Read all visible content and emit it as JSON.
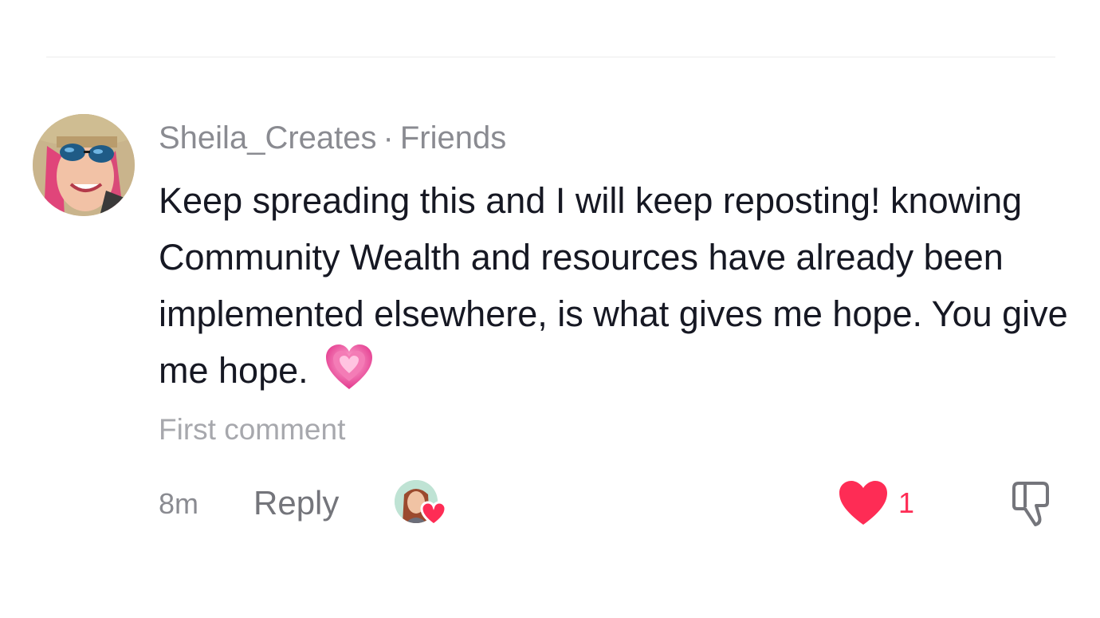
{
  "comment": {
    "username": "Sheila_Creates",
    "separator": "·",
    "relationship": "Friends",
    "text": "Keep spreading this and I will keep reposting! knowing Community Wealth and resources have already been implemented elsewhere, is what gives me hope. You give me hope.",
    "emoji": "growing-heart-emoji",
    "label": "First comment",
    "time": "8m",
    "reply_label": "Reply",
    "like_count": "1",
    "liked_by_creator": true
  },
  "colors": {
    "like": "#fe2c55",
    "meta": "#8a8b91",
    "text": "#161823"
  },
  "icons": {
    "avatar": "user-avatar",
    "creator": "creator-avatar",
    "like": "heart-icon",
    "dislike": "thumbs-down-icon"
  }
}
